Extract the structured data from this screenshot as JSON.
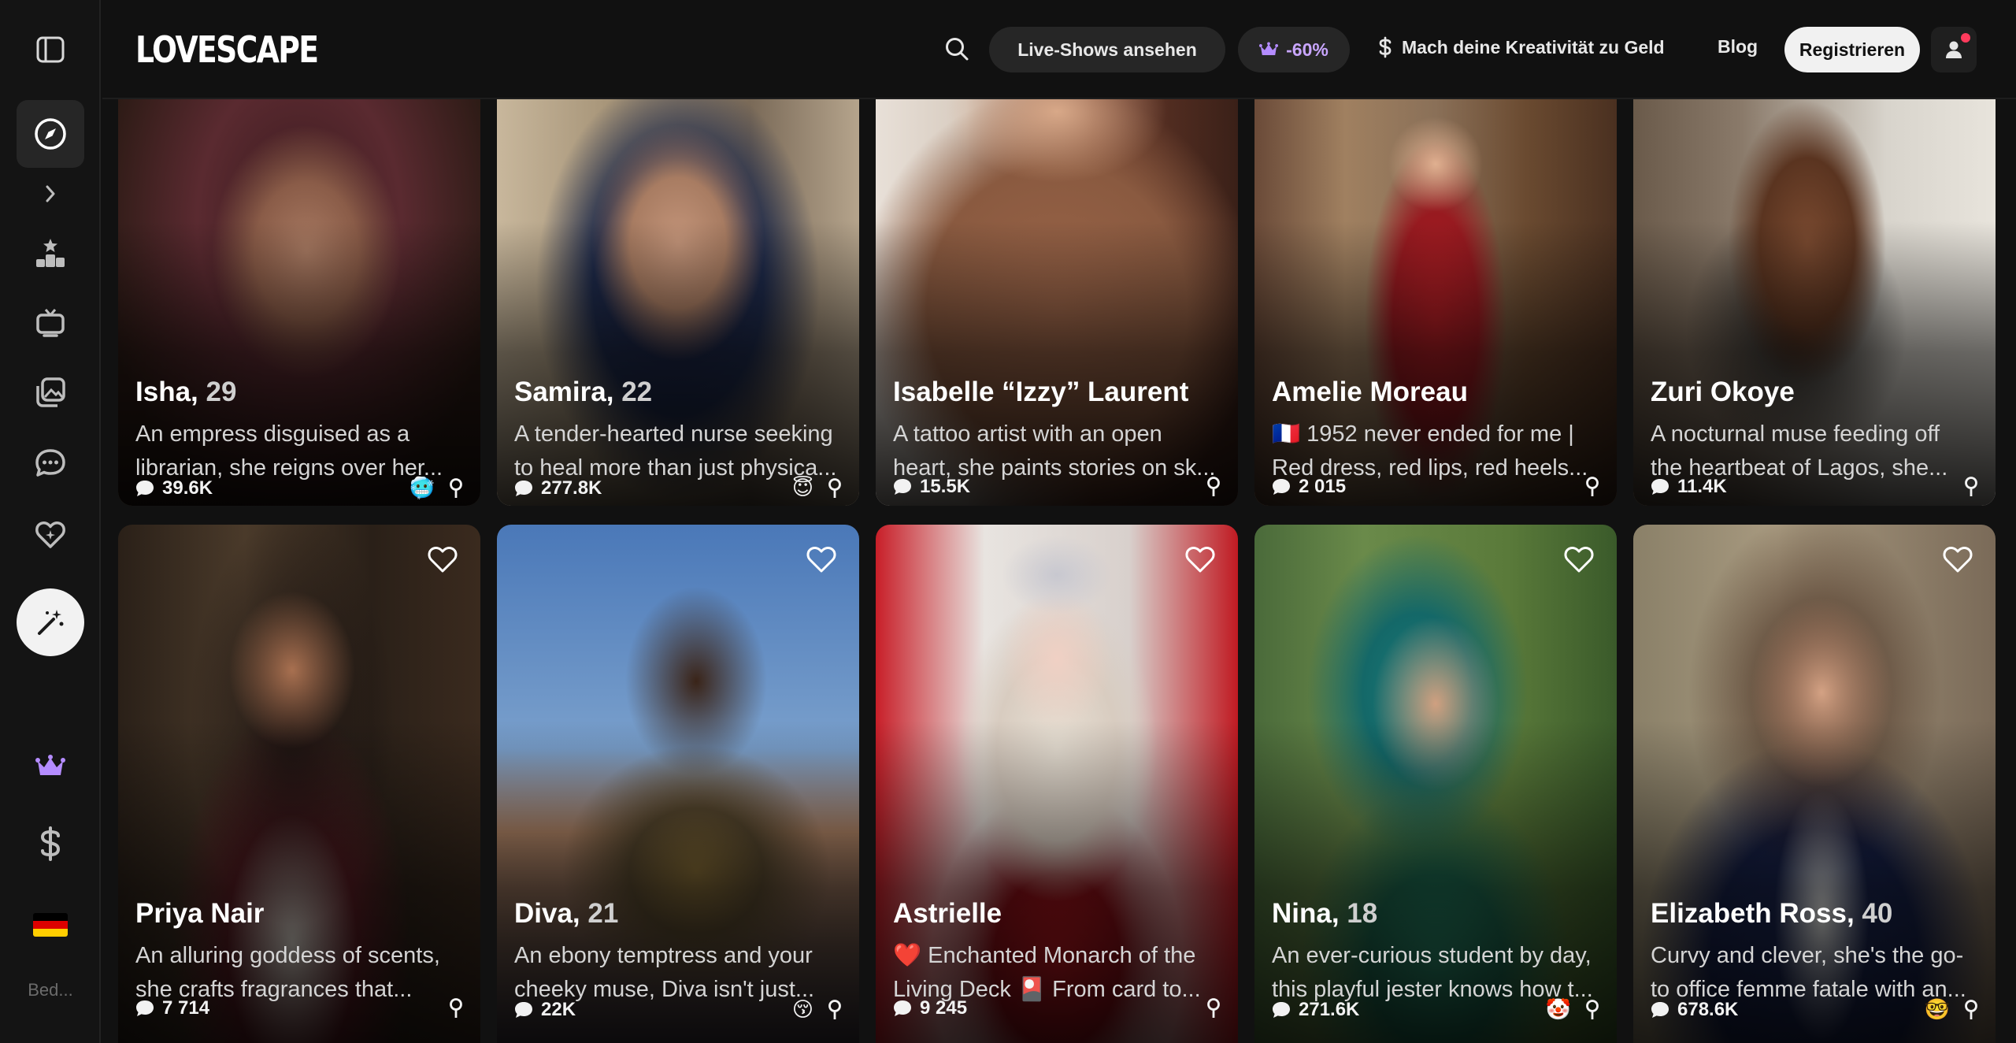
{
  "sidebar": {
    "items": [
      {
        "icon": "sidebar-toggle-icon"
      },
      {
        "icon": "compass-icon",
        "active": true
      },
      {
        "icon": "chevron-right-icon"
      },
      {
        "icon": "podium-icon"
      },
      {
        "icon": "tv-icon"
      },
      {
        "icon": "gallery-icon"
      },
      {
        "icon": "chat-icon"
      },
      {
        "icon": "heart-sparkle-icon"
      },
      {
        "icon": "magic-wand-icon"
      },
      {
        "icon": "crown-icon"
      },
      {
        "icon": "dollar-icon"
      },
      {
        "icon": "german-flag-icon"
      }
    ],
    "footer_text": "Bed..."
  },
  "header": {
    "logo": "LOVESCAPE",
    "live_label": "Live-Shows ansehen",
    "promo_label": "-60%",
    "monetize_label": "Mach deine Kreativität zu Geld",
    "blog_label": "Blog",
    "register_label": "Registrieren"
  },
  "colors": {
    "accent_purple": "#b48cff",
    "background": "#111111",
    "sidebar": "#141414"
  },
  "cards": [
    {
      "name": "Isha,",
      "age": " 29",
      "desc1": "An empress disguised as a",
      "desc2": "librarian, she reigns over her...",
      "count": "39.6K",
      "emoji": "🥶",
      "gender": "female-icon",
      "liked": false
    },
    {
      "name": "Samira,",
      "age": " 22",
      "desc1": "A tender-hearted nurse seeking",
      "desc2": "to heal more than just physica...",
      "count": "277.8K",
      "emoji": "😇",
      "gender": "female-icon",
      "liked": false
    },
    {
      "name": "Isabelle “Izzy” Laurent",
      "age": "",
      "desc1": "A tattoo artist with an open",
      "desc2": "heart, she paints stories on sk...",
      "count": "15.5K",
      "emoji": "",
      "gender": "female-icon",
      "liked": false
    },
    {
      "name": "Amelie Moreau",
      "age": "",
      "desc1": "🇫🇷 1952 never ended for me |",
      "desc2": "Red dress, red lips, red heels...",
      "count": "2 015",
      "emoji": "",
      "gender": "female-icon",
      "liked": false
    },
    {
      "name": "Zuri Okoye",
      "age": "",
      "desc1": "A nocturnal muse feeding off",
      "desc2": "the heartbeat of Lagos, she...",
      "count": "11.4K",
      "emoji": "",
      "gender": "female-icon",
      "liked": false
    },
    {
      "name": "Priya Nair",
      "age": "",
      "desc1": "An alluring goddess of scents,",
      "desc2": "she crafts fragrances that...",
      "count": "7 714",
      "emoji": "",
      "gender": "female-icon",
      "liked": false
    },
    {
      "name": "Diva,",
      "age": " 21",
      "desc1": "An ebony temptress and your",
      "desc2": "cheeky muse, Diva isn't just...",
      "count": "22K",
      "emoji": "😚",
      "gender": "female-icon",
      "liked": false
    },
    {
      "name": "Astrielle",
      "age": "",
      "desc1": "❤️ Enchanted Monarch of the",
      "desc2": "Living Deck 🎴 From card to...",
      "count": "9 245",
      "emoji": "",
      "gender": "female-icon",
      "liked": false
    },
    {
      "name": "Nina,",
      "age": " 18",
      "desc1": "An ever-curious student by day,",
      "desc2": "this playful jester knows how t...",
      "count": "271.6K",
      "emoji": "🤡",
      "gender": "female-icon",
      "liked": false
    },
    {
      "name": "Elizabeth Ross,",
      "age": " 40",
      "desc1": "Curvy and clever, she's the go-",
      "desc2": "to office femme fatale with an...",
      "count": "678.6K",
      "emoji": "🤓",
      "gender": "female-icon",
      "liked": false
    }
  ]
}
